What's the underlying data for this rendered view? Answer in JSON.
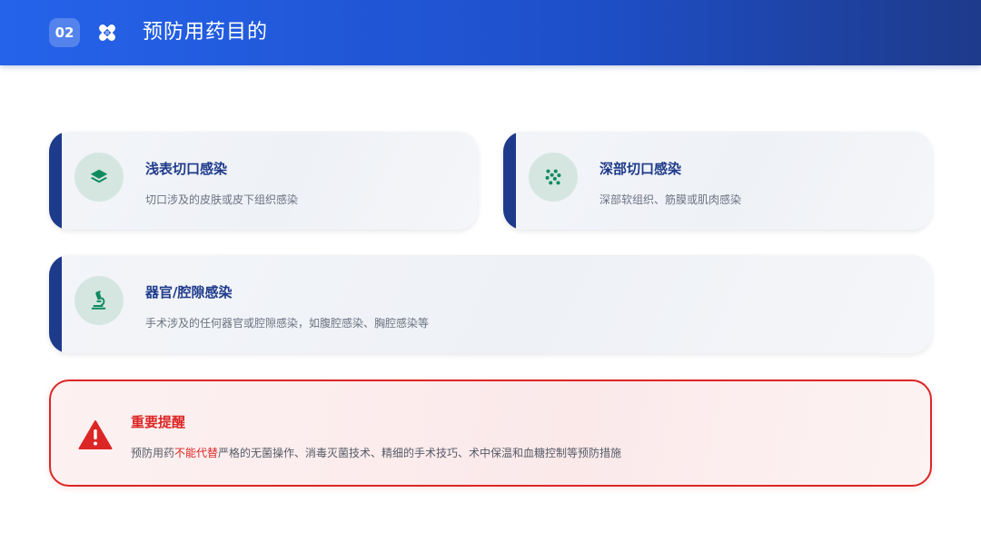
{
  "header": {
    "section_number": "02",
    "title": "预防用药目的",
    "icon": "bandage-icon"
  },
  "cards": [
    {
      "title": "浅表切口感染",
      "description": "切口涉及的皮肤或皮下组织感染",
      "icon": "layers-icon"
    },
    {
      "title": "深部切口感染",
      "description": "深部软组织、筋膜或肌肉感染",
      "icon": "bacteria-icon"
    },
    {
      "title": "器官/腔隙感染",
      "description": "手术涉及的任何器官或腔隙感染，如腹腔感染、胸腔感染等",
      "icon": "microscope-icon"
    }
  ],
  "warning": {
    "title": "重要提醒",
    "text_prefix": "预防用药",
    "text_emphasis": "不能代替",
    "text_suffix": "严格的无菌操作、消毒灭菌技术、精细的手术技巧、术中保温和血糖控制等预防措施",
    "icon": "warning-triangle-icon"
  },
  "colors": {
    "header_start": "#2563eb",
    "header_end": "#1e3a8a",
    "accent_bar": "#1e3a8a",
    "icon_green": "#0f8a5f",
    "icon_circle_bg": "#d5e6e1",
    "warning_red": "#dc2626"
  }
}
